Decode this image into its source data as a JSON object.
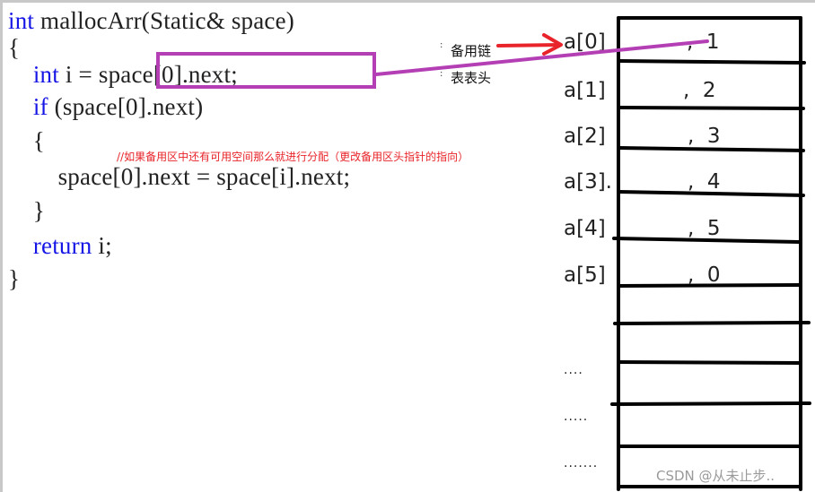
{
  "code": {
    "lines": [
      {
        "kw": "int",
        "rest": " mallocArr(Static& space)"
      },
      {
        "rest": "{"
      },
      {
        "indent": "    ",
        "kw": "int",
        "rest": " i = space[0].next;"
      },
      {
        "indent": "    ",
        "kw": "if",
        "rest": " (space[0].next)"
      },
      {
        "rest": "    {"
      },
      {
        "rest": "        space[0].next = space[i].next;"
      },
      {
        "rest": "    }"
      },
      {
        "indent": "    ",
        "kw": "return",
        "rest": " i;"
      },
      {
        "rest": "}"
      }
    ],
    "comment": "//如果备用区中还有可用空间那么就进行分配（更改备用区头指针的指向）",
    "highlighted_expression": "space[0].next;"
  },
  "annotations": {
    "spare_chain_label": "备用链",
    "list_head_label": "表表头",
    "red_arrow_color": "#e8242a",
    "purple_link_color": "#b43fb4"
  },
  "array": {
    "cells": [
      {
        "index": "a[0]",
        "value": ",  1"
      },
      {
        "index": "a[1]",
        "value": ",  2"
      },
      {
        "index": "a[2]",
        "value": ",  3"
      },
      {
        "index": "a[3].",
        "value": ",  4"
      },
      {
        "index": "a[4]",
        "value": ",  5"
      },
      {
        "index": "a[5]",
        "value": ",  0"
      }
    ],
    "ellipses": [
      "....",
      ".....",
      "......."
    ]
  },
  "watermark": "CSDN @从未止步.."
}
